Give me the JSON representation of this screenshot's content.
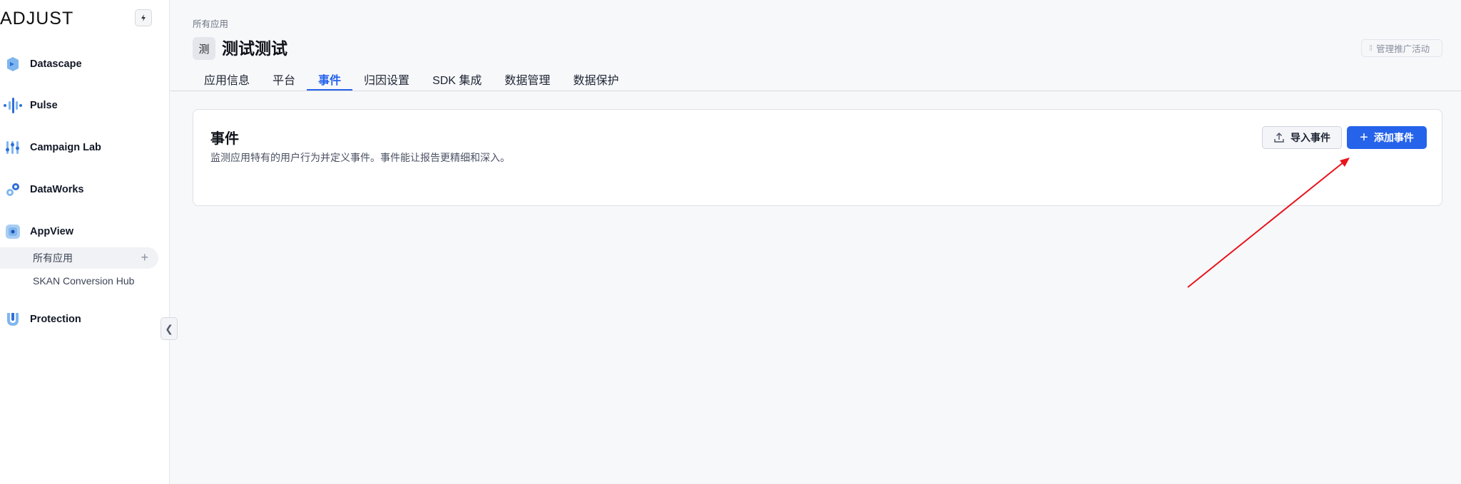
{
  "sidebar": {
    "logo": "ADJUST",
    "items": [
      {
        "label": "Datascape"
      },
      {
        "label": "Pulse"
      },
      {
        "label": "Campaign Lab"
      },
      {
        "label": "DataWorks"
      },
      {
        "label": "AppView"
      },
      {
        "label": "Protection"
      }
    ],
    "sub_items": [
      {
        "label": "所有应用"
      },
      {
        "label": "SKAN Conversion Hub"
      }
    ],
    "collapse_glyph": "❮"
  },
  "header": {
    "breadcrumb": "所有应用",
    "app_badge": "测",
    "app_title": "测试测试",
    "manage_label": "管理推广活动"
  },
  "tabs": [
    {
      "label": "应用信息"
    },
    {
      "label": "平台"
    },
    {
      "label": "事件"
    },
    {
      "label": "归因设置"
    },
    {
      "label": "SDK 集成"
    },
    {
      "label": "数据管理"
    },
    {
      "label": "数据保护"
    }
  ],
  "events_card": {
    "title": "事件",
    "description": "监测应用特有的用户行为并定义事件。事件能让报告更精细和深入。",
    "import_label": "导入事件",
    "add_label": "添加事件"
  },
  "colors": {
    "accent": "#2563eb",
    "annotation_arrow": "#e8141c"
  }
}
